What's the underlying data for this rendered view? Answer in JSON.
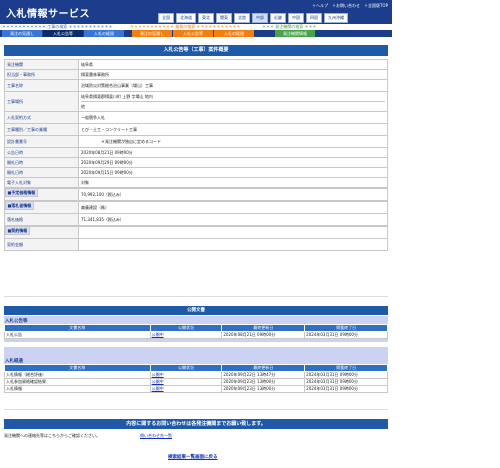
{
  "header": {
    "logo": "入札情報サービス",
    "top_links": [
      "＋ヘルプ",
      "＋お問い合わせ",
      "＋全国版TOP"
    ],
    "regions": [
      "全国",
      "北海道",
      "東北",
      "関東",
      "北陸",
      "中部",
      "近畿",
      "中国",
      "四国",
      "九州沖縄"
    ],
    "section_koji": "＊＊＊＊＊＊＊＊＊＊＊ 工事の検索 ＊＊＊＊＊＊＊＊＊＊＊",
    "section_gyomu": "＊＊＊＊＊＊＊＊＊＊＊ 業務の検索 ＊＊＊＊＊＊＊＊＊＊＊",
    "section_kikan": "＊＊＊ 発注機関の検索 ＊＊＊",
    "tabs": [
      "発注の見通し",
      "入札公告等",
      "入札の経過",
      "発注の見通し",
      "入札公告等",
      "入札の経過",
      "発注機関情報"
    ]
  },
  "title": "入札公告等（工事）案件概要",
  "detail": {
    "rows": [
      {
        "label": "発注機関",
        "value": "岐阜県"
      },
      {
        "label": "担当部・事務所",
        "value": "揖斐農林事務所"
      },
      {
        "label": "工事名称",
        "value": "治域防災対策総合治山事業（場山）工事"
      },
      {
        "label": "工事場所",
        "value": "岐阜県揖斐郡揖斐川町 上野 字場山 地内",
        "value2": "他"
      },
      {
        "label": "入札契約方式",
        "value": "一般競争入札"
      },
      {
        "label": "工事種別／工事の業種",
        "value": "とび・土工・コンクリート工事"
      },
      {
        "label": "設計書番号",
        "value": "＊発注機関が独自に定めるコード"
      },
      {
        "label": "公告日時",
        "value": "2020年08月21日 09時00分"
      },
      {
        "label": "開札日時",
        "value": "2020年09月29日 09時00分"
      },
      {
        "label": "開札日時",
        "value": "2020年09月15日 09時00分"
      },
      {
        "label": "電子入札対象",
        "value": "対象"
      }
    ],
    "section_yotei": "■予定価格情報",
    "yotei_label": "予定価格",
    "yotei_value": "70,992,100（税込み）",
    "section_rakusatsu": "■落札者情報",
    "rakusatsu_name_label": "落札者名",
    "rakusatsu_name_value": "森廣建設（株）",
    "rakusatsu_price_label": "落札価格",
    "rakusatsu_price_value": "71,341,835（税込み）",
    "section_keiyaku": "■契約情報",
    "keiyaku_name_label": "契約者名",
    "keiyaku_price_label": "契約金額"
  },
  "docs": {
    "title": "公開文書",
    "group1": "入札公告等",
    "group2": "入札経過",
    "columns": [
      "文書名称",
      "公開状況",
      "最終更新日",
      "掲載終了日"
    ],
    "group1_rows": [
      [
        "入札公告",
        "公開中",
        "2020年08月21日 09時00分",
        "2024年03月31日 09時00分"
      ]
    ],
    "group2_rows": [
      [
        "入札情報（総合評価）",
        "公開中",
        "2020年09月22日 13時47分",
        "2024年03月31日 09時00分"
      ],
      [
        "入札参加資格確認結果",
        "公開中",
        "2020年09月23日 13時00分",
        "2024年03月31日 09時00分"
      ],
      [
        "入札情報",
        "公開中",
        "2020年09月23日 13時00分",
        "2024年03月31日 09時00分"
      ]
    ]
  },
  "contact": {
    "title": "内容に関するお問い合わせは各発注機関までお願い致します。",
    "text": "発注機関への連絡先等はこちらからご確認ください。",
    "link": "問い合わせ先一覧"
  },
  "back_link": "検索結果一覧画面に戻る",
  "colors": {
    "navy": "#1b3d8c",
    "blue": "#1e5aa8",
    "orange": "#f08010",
    "green": "#4aa34a",
    "lavender": "#ccd2f1"
  }
}
